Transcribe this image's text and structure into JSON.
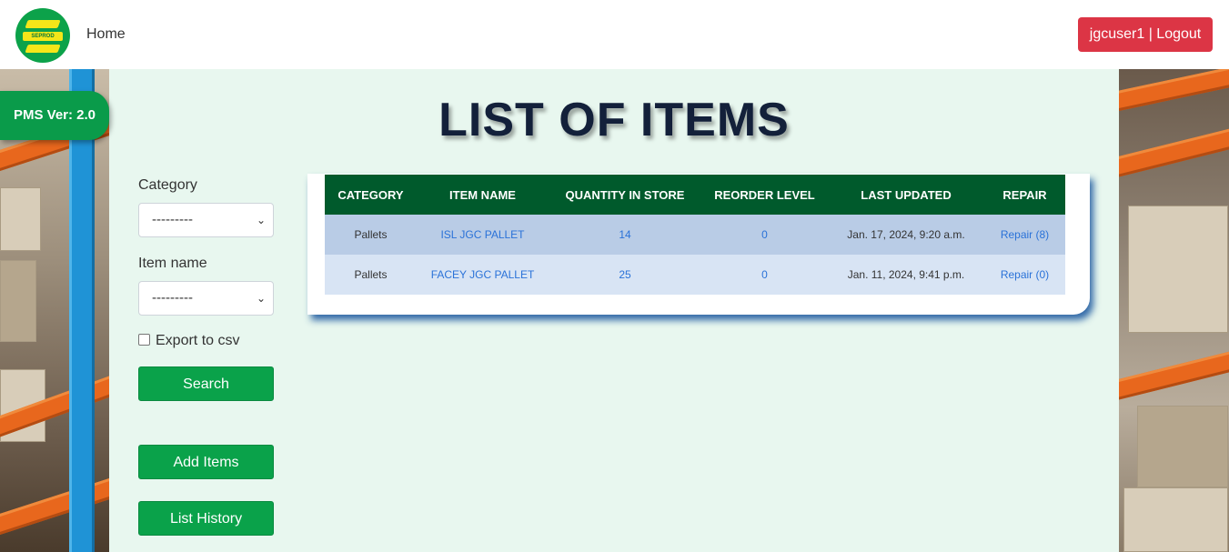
{
  "navbar": {
    "logo_text": "SEPROD",
    "home_label": "Home",
    "logout_label": "jgcuser1 | Logout"
  },
  "version_badge": "PMS Ver: 2.0",
  "page_title": "LIST OF ITEMS",
  "filters": {
    "category_label": "Category",
    "category_value": "---------",
    "item_name_label": "Item name",
    "item_name_value": "---------",
    "export_label": "Export to csv",
    "export_checked": false,
    "search_label": "Search",
    "add_items_label": "Add Items",
    "list_history_label": "List History"
  },
  "table": {
    "headers": [
      "CATEGORY",
      "ITEM NAME",
      "QUANTITY IN STORE",
      "REORDER LEVEL",
      "LAST UPDATED",
      "REPAIR"
    ],
    "rows": [
      {
        "category": "Pallets",
        "item_name": "ISL JGC PALLET",
        "quantity": "14",
        "reorder": "0",
        "updated": "Jan. 17, 2024, 9:20 a.m.",
        "repair": "Repair (8)"
      },
      {
        "category": "Pallets",
        "item_name": "FACEY JGC PALLET",
        "quantity": "25",
        "reorder": "0",
        "updated": "Jan. 11, 2024, 9:41 p.m.",
        "repair": "Repair (0)"
      }
    ]
  },
  "colors": {
    "brand_green": "#0aa24a",
    "header_green": "#005a2c",
    "logout_red": "#dc3545",
    "link_blue": "#2a72d8",
    "panel_bg": "#e8f7ef"
  }
}
